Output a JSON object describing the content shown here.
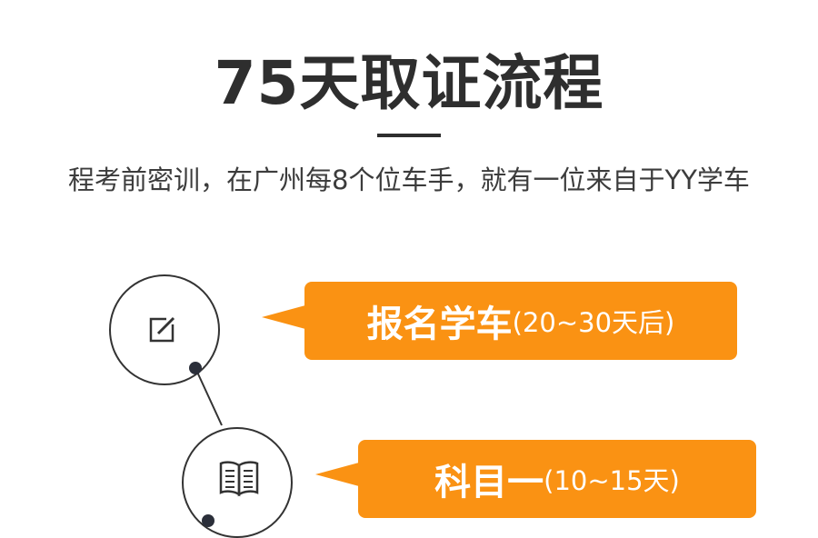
{
  "header": {
    "title": "75天取证流程",
    "subtitle": "程考前密训，在广州每8个位车手，就有一位来自于YY学车"
  },
  "steps": [
    {
      "title": "报名学车",
      "duration": "(20~30天后)",
      "icon": "edit-icon"
    },
    {
      "title": "科目一",
      "duration": "(10~15天)",
      "icon": "book-icon"
    }
  ],
  "colors": {
    "accent": "#fa9213",
    "title": "#2e2e2e",
    "subtitle": "#3c3c3c",
    "circle_stroke": "#333333",
    "dot": "#2b2f3a"
  }
}
